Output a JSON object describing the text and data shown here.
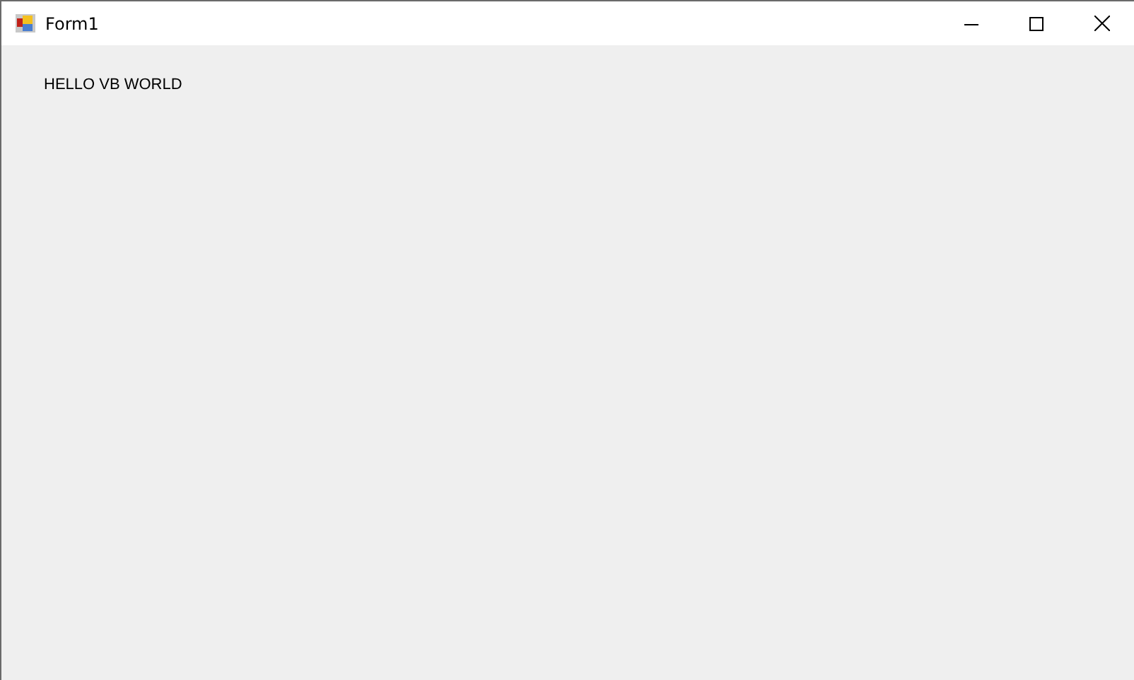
{
  "window": {
    "title": "Form1"
  },
  "label": "HELLO VB WORLD"
}
